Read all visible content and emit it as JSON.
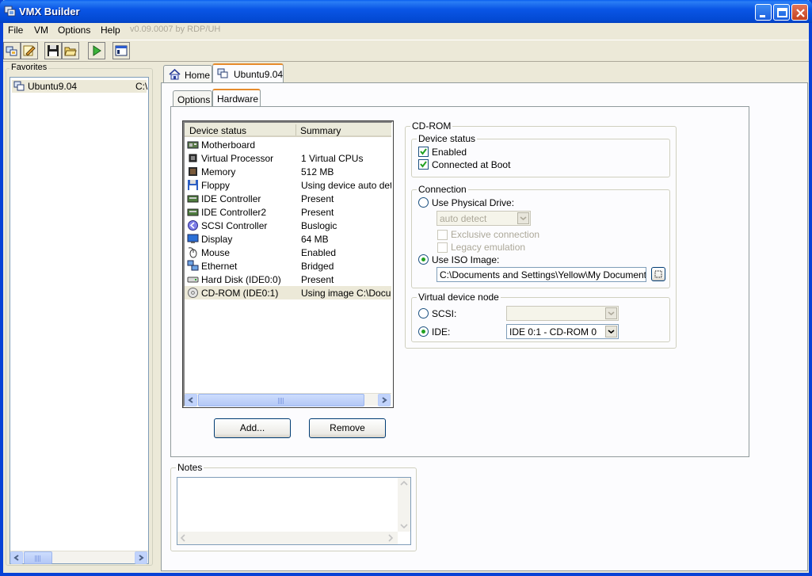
{
  "window": {
    "title": "VMX Builder"
  },
  "menu": {
    "items": [
      "File",
      "VM",
      "Options",
      "Help"
    ],
    "version": "v0.09.0007 by RDP/UH"
  },
  "favorites": {
    "label": "Favorites",
    "items": [
      {
        "name": "Ubuntu9.04",
        "path": "C:\\"
      }
    ]
  },
  "main_tabs": [
    {
      "label": "Home",
      "active": false
    },
    {
      "label": "Ubuntu9.04",
      "active": true
    }
  ],
  "sub_tabs": [
    {
      "label": "Options",
      "active": false
    },
    {
      "label": "Hardware",
      "active": true
    }
  ],
  "device_list": {
    "columns": [
      "Device status",
      "Summary"
    ],
    "rows": [
      {
        "name": "Motherboard",
        "summary": "",
        "icon": "motherboard-icon"
      },
      {
        "name": "Virtual Processor",
        "summary": "1 Virtual CPUs",
        "icon": "processor-icon"
      },
      {
        "name": "Memory",
        "summary": "512 MB",
        "icon": "memory-icon"
      },
      {
        "name": "Floppy",
        "summary": "Using device auto detect",
        "icon": "floppy-icon"
      },
      {
        "name": "IDE Controller",
        "summary": "Present",
        "icon": "ide-controller-icon"
      },
      {
        "name": "IDE Controller2",
        "summary": "Present",
        "icon": "ide-controller-icon"
      },
      {
        "name": "SCSI Controller",
        "summary": "Buslogic",
        "icon": "scsi-controller-icon"
      },
      {
        "name": "Display",
        "summary": "64 MB",
        "icon": "display-icon"
      },
      {
        "name": "Mouse",
        "summary": "Enabled",
        "icon": "mouse-icon"
      },
      {
        "name": "Ethernet",
        "summary": "Bridged",
        "icon": "ethernet-icon"
      },
      {
        "name": "Hard Disk (IDE0:0)",
        "summary": "Present",
        "icon": "hard-disk-icon"
      },
      {
        "name": "CD-ROM (IDE0:1)",
        "summary": "Using image C:\\Documents",
        "icon": "cdrom-icon",
        "selected": true
      }
    ],
    "add_label": "Add...",
    "remove_label": "Remove"
  },
  "cdrom": {
    "title": "CD-ROM",
    "device_status": {
      "label": "Device status",
      "enabled_label": "Enabled",
      "enabled": true,
      "connected_label": "Connected at Boot",
      "connected": true
    },
    "connection": {
      "label": "Connection",
      "physical_label": "Use Physical Drive:",
      "physical_value": "auto detect",
      "exclusive_label": "Exclusive connection",
      "legacy_label": "Legacy emulation",
      "iso_label": "Use ISO Image:",
      "iso_path": "C:\\Documents and Settings\\Yellow\\My Documents\\ISO"
    },
    "vdn": {
      "label": "Virtual device node",
      "scsi_label": "SCSI:",
      "scsi_value": "",
      "ide_label": "IDE:",
      "ide_value": "IDE 0:1 - CD-ROM 0"
    }
  },
  "notes": {
    "label": "Notes",
    "value": ""
  }
}
